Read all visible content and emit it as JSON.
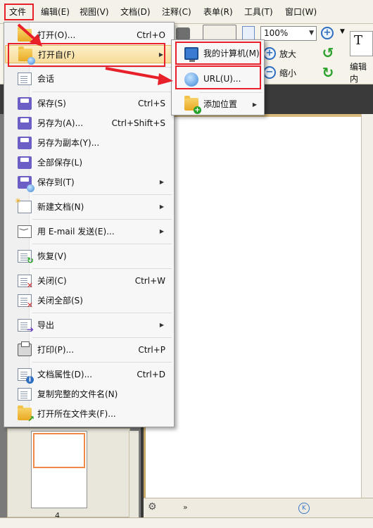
{
  "menubar": {
    "items": [
      "文件",
      "编辑(E)",
      "视图(V)",
      "文档(D)",
      "注释(C)",
      "表单(R)",
      "工具(T)",
      "窗口(W)"
    ]
  },
  "toolbar": {
    "zoom_value": "100%",
    "zoom_in_label": "放大",
    "zoom_out_label": "缩小",
    "edit_content_label": "编辑内"
  },
  "file_menu": {
    "items": [
      {
        "label": "打开(O)...",
        "shortcut": "Ctrl+O",
        "icon": "open-folder-icon",
        "submenu": false
      },
      {
        "label": "打开自(F)",
        "shortcut": "",
        "icon": "open-from-folder-icon",
        "submenu": true,
        "highlighted": true
      },
      {
        "label": "会话",
        "shortcut": "",
        "icon": "session-icon",
        "submenu": true
      },
      {
        "label": "保存(S)",
        "shortcut": "Ctrl+S",
        "icon": "save-icon",
        "submenu": false
      },
      {
        "label": "另存为(A)...",
        "shortcut": "Ctrl+Shift+S",
        "icon": "save-as-icon",
        "submenu": false
      },
      {
        "label": "另存为副本(Y)...",
        "shortcut": "",
        "icon": "save-copy-icon",
        "submenu": false
      },
      {
        "label": "全部保存(L)",
        "shortcut": "",
        "icon": "save-all-icon",
        "submenu": false
      },
      {
        "label": "保存到(T)",
        "shortcut": "",
        "icon": "save-to-icon",
        "submenu": true
      },
      {
        "label": "新建文档(N)",
        "shortcut": "",
        "icon": "new-document-icon",
        "submenu": true
      },
      {
        "label": "用 E-mail 发送(E)...",
        "shortcut": "",
        "icon": "email-icon",
        "submenu": true
      },
      {
        "label": "恢复(V)",
        "shortcut": "",
        "icon": "revert-icon",
        "submenu": false
      },
      {
        "label": "关闭(C)",
        "shortcut": "Ctrl+W",
        "icon": "close-document-icon",
        "submenu": false
      },
      {
        "label": "关闭全部(S)",
        "shortcut": "",
        "icon": "close-all-icon",
        "submenu": false
      },
      {
        "label": "导出",
        "shortcut": "",
        "icon": "export-icon",
        "submenu": true
      },
      {
        "label": "打印(P)...",
        "shortcut": "Ctrl+P",
        "icon": "print-icon",
        "submenu": false
      },
      {
        "label": "文档属性(D)...",
        "shortcut": "Ctrl+D",
        "icon": "document-properties-icon",
        "submenu": false
      },
      {
        "label": "复制完整的文件名(N)",
        "shortcut": "",
        "icon": "copy-filename-icon",
        "submenu": false
      },
      {
        "label": "打开所在文件夹(F)...",
        "shortcut": "",
        "icon": "open-containing-folder-icon",
        "submenu": false
      }
    ]
  },
  "open_from_submenu": {
    "items": [
      {
        "label": "我的计算机(M)",
        "icon": "my-computer-icon",
        "submenu": false
      },
      {
        "label": "URL(U)...",
        "icon": "url-globe-icon",
        "submenu": false
      },
      {
        "label": "添加位置",
        "icon": "add-location-icon",
        "submenu": true
      }
    ]
  },
  "thumbnail": {
    "page_number": "4"
  },
  "colors": {
    "highlight_red": "#e8202a",
    "menu_selected": "#f8dc9a"
  }
}
